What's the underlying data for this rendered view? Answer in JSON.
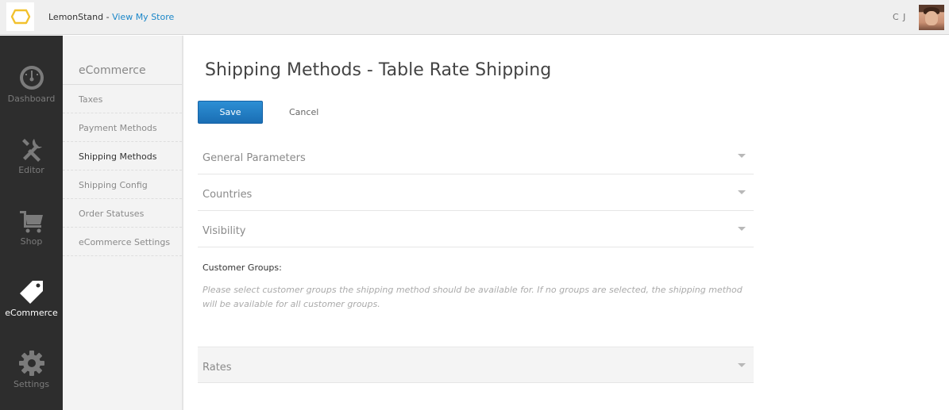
{
  "topbar": {
    "brand_name": "LemonStand",
    "separator": " - ",
    "view_store_link": "View My Store",
    "user_initials": "C J",
    "accent_color": "#1b87c9"
  },
  "left_nav": [
    {
      "label": "Dashboard",
      "icon": "dashboard-gauge-icon"
    },
    {
      "label": "Editor",
      "icon": "tools-icon"
    },
    {
      "label": "Shop",
      "icon": "shopping-cart-icon"
    },
    {
      "label": "eCommerce",
      "icon": "price-tag-icon",
      "active": true
    },
    {
      "label": "Settings",
      "icon": "gear-icon"
    }
  ],
  "sub_nav": {
    "title": "eCommerce",
    "items": [
      {
        "label": "Taxes"
      },
      {
        "label": "Payment Methods"
      },
      {
        "label": "Shipping Methods",
        "active": true
      },
      {
        "label": "Shipping Config"
      },
      {
        "label": "Order Statuses"
      },
      {
        "label": "eCommerce Settings"
      }
    ]
  },
  "main": {
    "page_title": "Shipping Methods - Table Rate Shipping",
    "save_label": "Save",
    "cancel_label": "Cancel",
    "sections": [
      {
        "title": "General Parameters"
      },
      {
        "title": "Countries"
      },
      {
        "title": "Visibility"
      }
    ],
    "customer_groups_label": "Customer Groups:",
    "customer_groups_help": "Please select customer groups the shipping method should be available for. If no groups are selected, the shipping method will be available for all customer groups.",
    "rates_title": "Rates"
  }
}
